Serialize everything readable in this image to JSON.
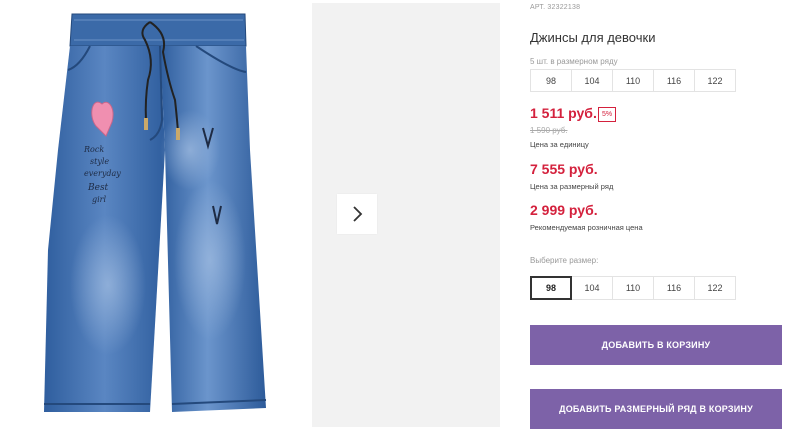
{
  "product": {
    "article": "АРТ. 32322138",
    "title": "Джинсы для девочки",
    "pack_label": "5 шт. в размерном ряду",
    "pack_sizes": [
      "98",
      "104",
      "110",
      "116",
      "122"
    ],
    "unit_price": "1 511 руб.",
    "discount": "5%",
    "old_price": "1 590 руб.",
    "unit_price_caption": "Цена за единицу",
    "pack_price": "7 555 руб.",
    "pack_price_caption": "Цена за размерный ряд",
    "retail_price": "2 999 руб.",
    "retail_price_caption": "Рекомендуемая розничная цена",
    "choose_size_label": "Выберите размер:",
    "size_options": [
      "98",
      "104",
      "110",
      "116",
      "122"
    ],
    "selected_size": "98"
  },
  "actions": {
    "add_to_cart": "ДОБАВИТЬ В КОРЗИНУ",
    "add_pack_to_cart": "ДОБАВИТЬ РАЗМЕРНЫЙ РЯД В КОРЗИНУ"
  },
  "gallery": {
    "next_icon": "chevron-right-icon",
    "embroidery_lines": [
      "Rock",
      "style",
      "everyday",
      "Best",
      "girl"
    ]
  },
  "colors": {
    "price": "#d4213d",
    "button": "#7d62a8",
    "denim": "#3a67a8"
  }
}
